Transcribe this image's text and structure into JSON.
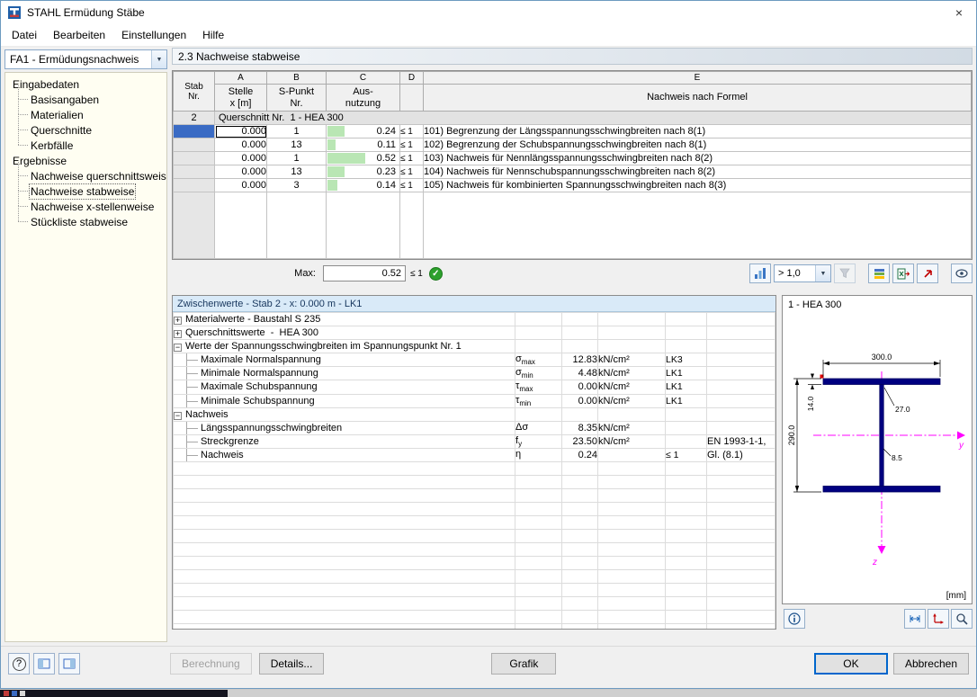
{
  "window": {
    "title": "STAHL Ermüdung Stäbe"
  },
  "icons": {
    "close": "×",
    "dropdown_arrow": "▼",
    "check": "✓",
    "help": "?",
    "expand_plus": "+",
    "expand_minus": "−"
  },
  "menu": [
    "Datei",
    "Bearbeiten",
    "Einstellungen",
    "Hilfe"
  ],
  "sidebar": {
    "case_selector": "FA1 - Ermüdungsnachweis",
    "tree": [
      {
        "label": "Eingabedaten",
        "level": 0,
        "selected": false
      },
      {
        "label": "Basisangaben",
        "level": 1,
        "selected": false
      },
      {
        "label": "Materialien",
        "level": 1,
        "selected": false
      },
      {
        "label": "Querschnitte",
        "level": 1,
        "selected": false
      },
      {
        "label": "Kerbfälle",
        "level": 1,
        "selected": false
      },
      {
        "label": "Ergebnisse",
        "level": 0,
        "selected": false
      },
      {
        "label": "Nachweise querschnittsweise",
        "level": 1,
        "selected": false
      },
      {
        "label": "Nachweise stabweise",
        "level": 1,
        "selected": true
      },
      {
        "label": "Nachweise x-stellenweise",
        "level": 1,
        "selected": false
      },
      {
        "label": "Stückliste stabweise",
        "level": 1,
        "selected": false
      }
    ]
  },
  "section_title": "2.3 Nachweise stabweise",
  "results_table": {
    "column_letters": [
      "A",
      "B",
      "C",
      "D",
      "E"
    ],
    "headers": {
      "stab_line1": "Stab",
      "stab_line2": "Nr.",
      "stelle_line1": "Stelle",
      "stelle_line2": "x [m]",
      "spunkt_line1": "S-Punkt",
      "spunkt_line2": "Nr.",
      "ausnutzung_line1": "Aus-",
      "ausnutzung_line2": "nutzung",
      "formel": "Nachweis nach Formel"
    },
    "group_row": {
      "stab_nr": "2",
      "label": "Querschnitt Nr.  1 - HEA 300"
    },
    "rows": [
      {
        "stelle": "0.000",
        "s_punkt": "1",
        "ausnutzung": 0.24,
        "ausnutzung_text": "0.24",
        "bedingung": "≤ 1",
        "formel": "101) Begrenzung der Längsspannungsschwingbreiten nach 8(1)",
        "selected": true
      },
      {
        "stelle": "0.000",
        "s_punkt": "13",
        "ausnutzung": 0.11,
        "ausnutzung_text": "0.11",
        "bedingung": "≤ 1",
        "formel": "102) Begrenzung der Schubspannungsschwingbreiten nach 8(1)",
        "selected": false
      },
      {
        "stelle": "0.000",
        "s_punkt": "1",
        "ausnutzung": 0.52,
        "ausnutzung_text": "0.52",
        "bedingung": "≤ 1",
        "formel": "103) Nachweis für Nennlängsspannungsschwingbreiten nach 8(2)",
        "selected": false
      },
      {
        "stelle": "0.000",
        "s_punkt": "13",
        "ausnutzung": 0.23,
        "ausnutzung_text": "0.23",
        "bedingung": "≤ 1",
        "formel": "104) Nachweis für Nennschubspannungsschwingbreiten nach 8(2)",
        "selected": false
      },
      {
        "stelle": "0.000",
        "s_punkt": "3",
        "ausnutzung": 0.14,
        "ausnutzung_text": "0.14",
        "bedingung": "≤ 1",
        "formel": "105) Nachweis für kombinierten Spannungsschwingbreiten nach 8(3)",
        "selected": false
      }
    ],
    "max": {
      "label": "Max:",
      "value": "0.52",
      "bedingung": "≤ 1"
    },
    "toolbar": {
      "threshold_value": "> 1,0"
    }
  },
  "details_table": {
    "header": "Zwischenwerte - Stab 2 - x: 0.000 m - LK1",
    "rows": [
      {
        "kind": "group",
        "state": "collapsed",
        "label": "Materialwerte - Baustahl S 235"
      },
      {
        "kind": "group",
        "state": "collapsed",
        "label": "Querschnittswerte  -  HEA 300"
      },
      {
        "kind": "group",
        "state": "expanded",
        "label": "Werte der Spannungsschwingbreiten im Spannungspunkt Nr. 1"
      },
      {
        "kind": "item",
        "label": "Maximale Normalspannung",
        "symbol": "σ",
        "subscript": "max",
        "value": "12.83",
        "unit": "kN/cm²",
        "condition": "LK3",
        "note": ""
      },
      {
        "kind": "item",
        "label": "Minimale Normalspannung",
        "symbol": "σ",
        "subscript": "min",
        "value": "4.48",
        "unit": "kN/cm²",
        "condition": "LK1",
        "note": ""
      },
      {
        "kind": "item",
        "label": "Maximale Schubspannung",
        "symbol": "τ",
        "subscript": "max",
        "value": "0.00",
        "unit": "kN/cm²",
        "condition": "LK1",
        "note": ""
      },
      {
        "kind": "item",
        "label": "Minimale Schubspannung",
        "symbol": "τ",
        "subscript": "min",
        "value": "0.00",
        "unit": "kN/cm²",
        "condition": "LK1",
        "note": ""
      },
      {
        "kind": "group",
        "state": "expanded",
        "label": "Nachweis"
      },
      {
        "kind": "item",
        "label": "Längsspannungsschwingbreiten",
        "symbol": "Δσ",
        "subscript": "",
        "value": "8.35",
        "unit": "kN/cm²",
        "condition": "",
        "note": ""
      },
      {
        "kind": "item",
        "label": "Streckgrenze",
        "symbol": "f",
        "subscript": "y",
        "value": "23.50",
        "unit": "kN/cm²",
        "condition": "",
        "note": "EN 1993-1-1,"
      },
      {
        "kind": "item",
        "label": "Nachweis",
        "symbol": "η",
        "subscript": "",
        "value": "0.24",
        "unit": "",
        "condition": "≤ 1",
        "note": "Gl. (8.1)"
      }
    ]
  },
  "graphic": {
    "title": "1 - HEA 300",
    "unit_label": "[mm]",
    "dimensions": {
      "width": "300.0",
      "flange_thickness": "14.0",
      "radius": "27.0",
      "height": "290.0",
      "web_thickness": "8.5"
    },
    "axes": {
      "horizontal": "y",
      "vertical": "z"
    }
  },
  "footer": {
    "berechnung": "Berechnung",
    "details": "Details...",
    "grafik": "Grafik",
    "ok": "OK",
    "abbrechen": "Abbrechen"
  },
  "colors": {
    "selection_blue": "#3a6bc4",
    "usage_bar_green": "#b9e6b4",
    "column_highlight_orange": "#f8ab46",
    "check_green": "#2ca02c",
    "axis_magenta": "#ff00ff",
    "section_navy": "#000080",
    "details_header_bg": "#d9eaf8"
  }
}
